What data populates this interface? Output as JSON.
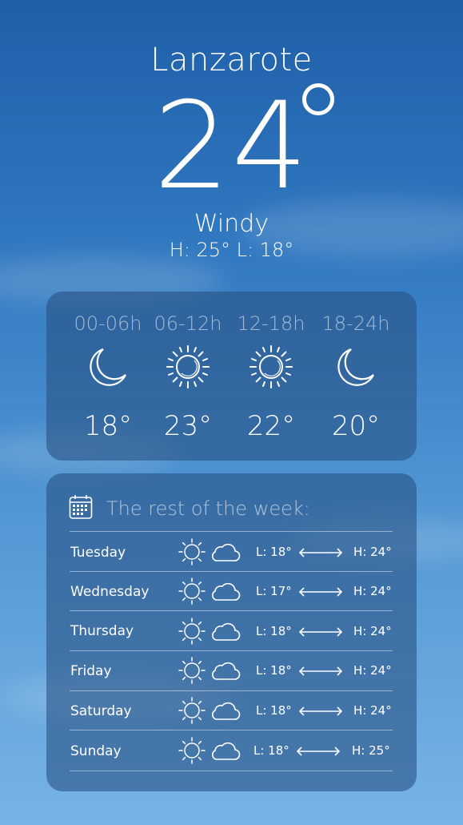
{
  "location": {
    "city": "Lanzarote"
  },
  "current": {
    "temperature": "24",
    "condition": "Windy",
    "high_low": "H: 25° L: 18°"
  },
  "periods": [
    {
      "label": "00-06h",
      "icon": "moon-icon",
      "temp": "18°"
    },
    {
      "label": "06-12h",
      "icon": "sun-icon",
      "temp": "23°"
    },
    {
      "label": "12-18h",
      "icon": "sun-icon",
      "temp": "22°"
    },
    {
      "label": "18-24h",
      "icon": "moon-icon",
      "temp": "20°"
    }
  ],
  "week": {
    "title": "The rest of the week:",
    "days": [
      {
        "day": "Tuesday",
        "low": "L: 18°",
        "high": "H: 24°"
      },
      {
        "day": "Wednesday",
        "low": "L: 17°",
        "high": "H: 24°"
      },
      {
        "day": "Thursday",
        "low": "L: 18°",
        "high": "H: 24°"
      },
      {
        "day": "Friday",
        "low": "L: 18°",
        "high": "H: 24°"
      },
      {
        "day": "Saturday",
        "low": "L: 18°",
        "high": "H: 24°"
      },
      {
        "day": "Sunday",
        "low": "L: 18°",
        "high": "H: 25°"
      }
    ]
  }
}
